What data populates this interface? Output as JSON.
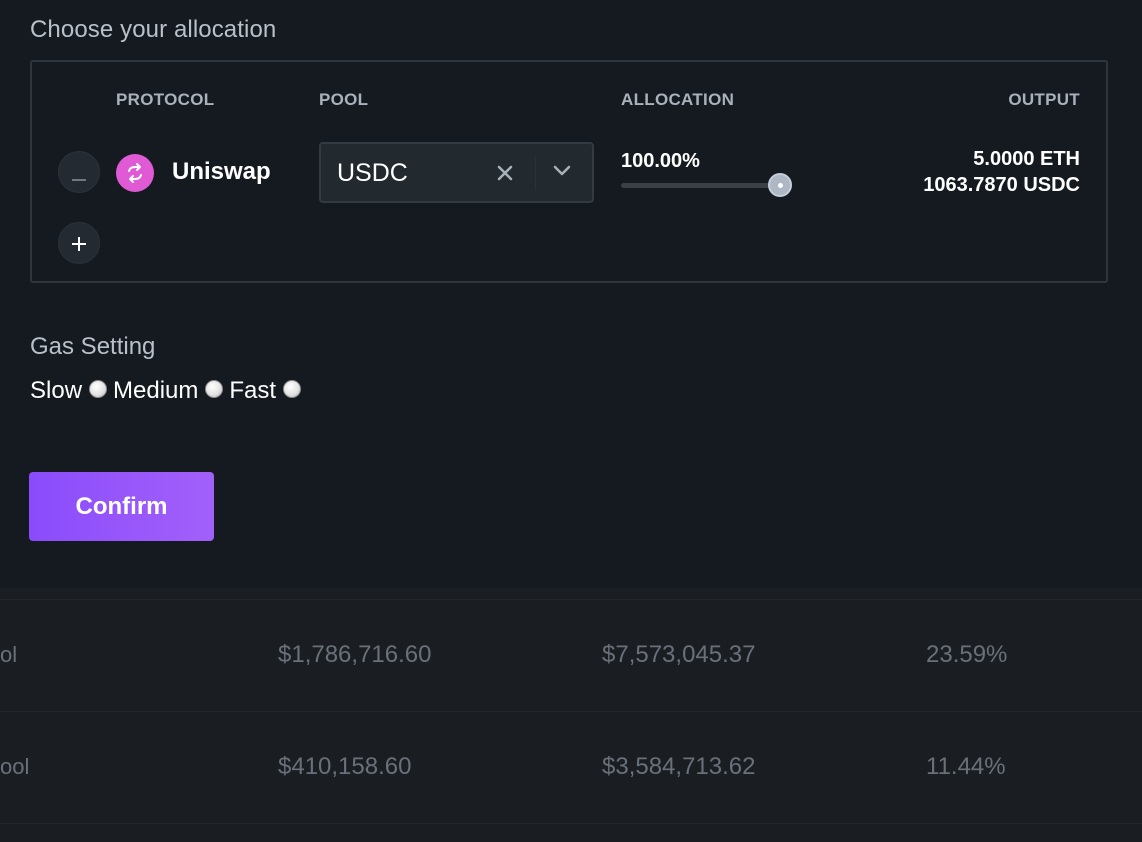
{
  "allocation": {
    "title": "Choose your allocation",
    "columns": {
      "protocol": "PROTOCOL",
      "pool": "POOL",
      "allocation": "ALLOCATION",
      "output": "OUTPUT"
    },
    "row": {
      "protocol_name": "Uniswap",
      "protocol_icon": "uniswap-icon",
      "protocol_icon_color": "#e05ad6",
      "pool_value": "USDC",
      "allocation_pct": "100.00%",
      "allocation_fraction": 1.0,
      "output_eth": "5.0000 ETH",
      "output_usdc": "1063.7870 USDC"
    },
    "remove_icon": "minus-icon",
    "add_icon": "plus-icon"
  },
  "gas": {
    "title": "Gas Setting",
    "options": [
      "Slow",
      "Medium",
      "Fast"
    ]
  },
  "confirm": {
    "label": "Confirm",
    "color": "#8a4cfb"
  },
  "table": {
    "rows": [
      {
        "name": "ol",
        "col1": "$1,786,716.60",
        "col2": "$7,573,045.37",
        "col3": "23.59%"
      },
      {
        "name": "ool",
        "col1": "$410,158.60",
        "col2": "$3,584,713.62",
        "col3": "11.44%"
      }
    ]
  }
}
